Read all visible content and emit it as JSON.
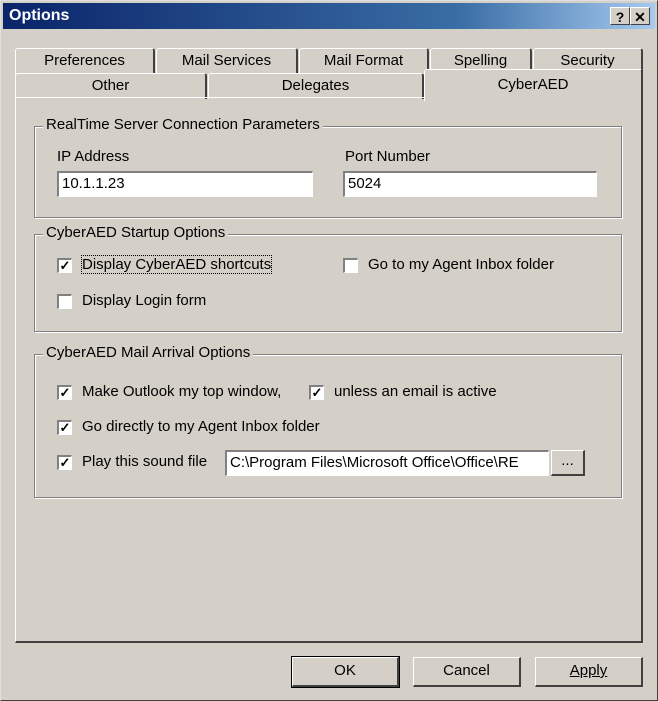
{
  "window": {
    "title": "Options",
    "help_label": "?",
    "close_label": "✕"
  },
  "tabs": {
    "row1": [
      "Preferences",
      "Mail Services",
      "Mail Format",
      "Spelling",
      "Security"
    ],
    "row2": [
      "Other",
      "Delegates",
      "CyberAED"
    ],
    "active": "CyberAED"
  },
  "connection": {
    "legend": "RealTime Server Connection Parameters",
    "ip_label": "IP Address",
    "ip_value": "10.1.1.23",
    "port_label": "Port Number",
    "port_value": "5024"
  },
  "startup": {
    "legend": "CyberAED Startup Options",
    "display_shortcuts": {
      "label": "Display CyberAED shortcuts",
      "checked": true
    },
    "go_to_inbox": {
      "label": "Go to my Agent Inbox folder",
      "checked": false
    },
    "display_login": {
      "label": "Display Login form",
      "checked": false
    }
  },
  "arrival": {
    "legend": "CyberAED Mail Arrival Options",
    "top_window": {
      "label": "Make Outlook my top window,",
      "checked": true
    },
    "unless_active": {
      "label": "unless an email is active",
      "checked": true
    },
    "go_directly": {
      "label": "Go directly to my Agent Inbox folder",
      "checked": true
    },
    "play_sound": {
      "label": "Play this sound file",
      "checked": true
    },
    "sound_path": "C:\\Program Files\\Microsoft Office\\Office\\RE",
    "browse_label": "..."
  },
  "buttons": {
    "ok": "OK",
    "cancel": "Cancel",
    "apply": "Apply"
  },
  "colors": {
    "face": "#d4d0c8",
    "title_start": "#0a246a",
    "title_end": "#a6caf0"
  }
}
